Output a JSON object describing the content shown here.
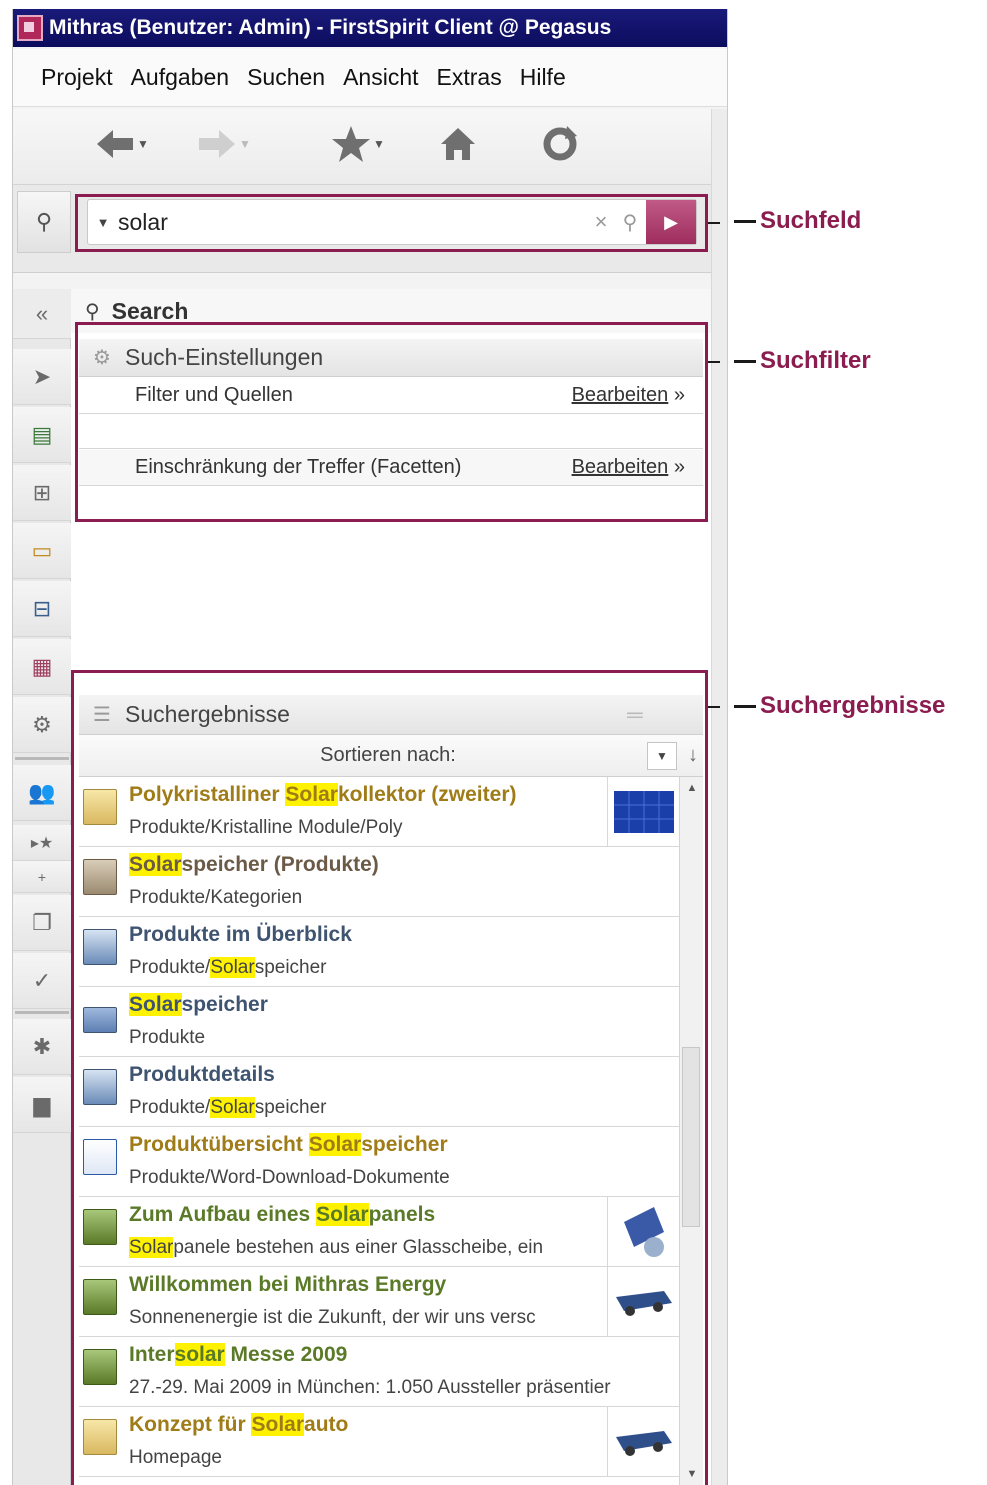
{
  "window": {
    "title": "Mithras (Benutzer: Admin) - FirstSpirit Client @ Pegasus"
  },
  "menu": [
    "Projekt",
    "Aufgaben",
    "Suchen",
    "Ansicht",
    "Extras",
    "Hilfe"
  ],
  "toolbar": {
    "icons": [
      "back-arrow-icon",
      "forward-arrow-icon",
      "favorites-star-icon",
      "home-icon",
      "reload-icon"
    ]
  },
  "search": {
    "value": "solar"
  },
  "panel": {
    "title": "Search",
    "collapse": "«"
  },
  "settings": {
    "title": "Such-Einstellungen",
    "filter_label": "Filter und Quellen",
    "filter_edit": "Bearbeiten",
    "facet_label": "Einschränkung der Treffer (Facetten)",
    "facet_edit": "Bearbeiten",
    "edit_arrows": "»"
  },
  "results_section": {
    "title": "Suchergebnisse",
    "sort_label": "Sortieren nach:"
  },
  "results": [
    {
      "pre": "Polykristalliner ",
      "hl": "Solar",
      "post": "kollektor (zweiter)",
      "path_pre": "Produkte/Kristalline Module/Poly",
      "path_hl": "",
      "path_post": "",
      "color": "#9f7c18",
      "icon": "image-icon",
      "thumb": "solar-panel-thumbnail"
    },
    {
      "pre": "",
      "hl": "Solar",
      "post": "speicher (Produkte)",
      "path_pre": "Produkte/Kategorien",
      "path_hl": "",
      "path_post": "",
      "color": "#6b5a45",
      "icon": "dataset-icon",
      "thumb": ""
    },
    {
      "pre": "Produkte im Überblick",
      "hl": "",
      "post": "",
      "path_pre": "Produkte/",
      "path_hl": "Solar",
      "path_post": "speicher",
      "color": "#3f5470",
      "icon": "page-reference-icon",
      "thumb": ""
    },
    {
      "pre": "",
      "hl": "Solar",
      "post": "speicher",
      "path_pre": "Produkte",
      "path_hl": "",
      "path_post": "",
      "color": "#3f5470",
      "icon": "folder-icon",
      "thumb": ""
    },
    {
      "pre": "Produktdetails",
      "hl": "",
      "post": "",
      "path_pre": "Produkte/",
      "path_hl": "Solar",
      "path_post": "speicher",
      "color": "#3f5470",
      "icon": "page-reference-icon",
      "thumb": ""
    },
    {
      "pre": "Produktübersicht ",
      "hl": "Solar",
      "post": "speicher",
      "path_pre": "Produkte/Word-Download-Dokumente",
      "path_hl": "",
      "path_post": "",
      "color": "#9f7c18",
      "icon": "word-document-icon",
      "thumb": ""
    },
    {
      "pre": "Zum Aufbau eines ",
      "hl": "Solar",
      "post": "panels",
      "path_pre": "",
      "path_hl": "Solar",
      "path_post": "panele bestehen aus einer Glasscheibe, ein",
      "color": "#5a7a28",
      "icon": "page-icon",
      "thumb": "satellite-thumbnail"
    },
    {
      "pre": "Willkommen bei Mithras Energy",
      "hl": "",
      "post": "",
      "path_pre": "Sonnenenergie ist die Zukunft, der wir uns versc",
      "path_hl": "",
      "path_post": "",
      "color": "#5a7a28",
      "icon": "page-icon",
      "thumb": "solar-car-thumbnail"
    },
    {
      "pre": "Inter",
      "hl": "solar",
      "post": " Messe 2009",
      "path_pre": "27.-29. Mai 2009 in München: 1.050 Aussteller präsentier",
      "path_hl": "",
      "path_post": "",
      "color": "#5a7a28",
      "icon": "page-icon",
      "thumb": ""
    },
    {
      "pre": "Konzept für ",
      "hl": "Solar",
      "post": "auto",
      "path_pre": "Homepage",
      "path_hl": "",
      "path_post": "",
      "color": "#9f7c18",
      "icon": "image-icon",
      "thumb": "solar-car-thumbnail"
    }
  ],
  "callouts": {
    "search_field": "Suchfeld",
    "search_filter": "Suchfilter",
    "search_results": "Suchergebnisse"
  },
  "colors": {
    "frame": "#8b1c4f",
    "titlebar": "#0c0c5e",
    "highlight": "#fff200"
  }
}
